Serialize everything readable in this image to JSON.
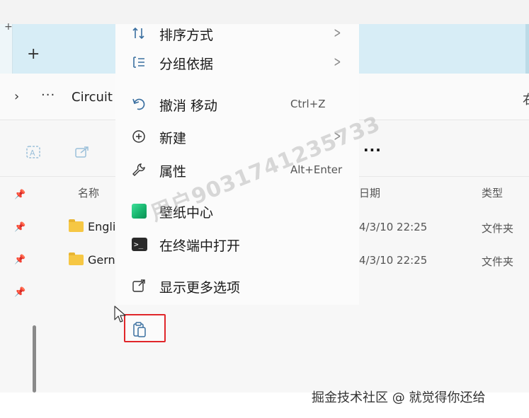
{
  "explorer": {
    "top_plus": "+",
    "new_tab_icon": "plus-icon",
    "new_tab_label": "+",
    "address": {
      "chevron": "›",
      "more": "···",
      "crumb": "Circuit",
      "right_glyph": "右"
    },
    "command_bar": {
      "more": "···",
      "icons": [
        "rename-icon",
        "share-icon"
      ]
    },
    "columns": {
      "name": "名称",
      "date": "日期",
      "type": "类型"
    },
    "rows": [
      {
        "name": "Engli",
        "date": "4/3/10 22:25",
        "type": "文件夹"
      },
      {
        "name": "Gern",
        "date": "4/3/10 22:25",
        "type": "文件夹"
      }
    ]
  },
  "context_menu": {
    "items": [
      {
        "label": "排序方式",
        "icon": "sort-icon",
        "has_submenu": true
      },
      {
        "label": "分组依据",
        "icon": "group-icon",
        "has_submenu": true
      },
      {
        "label": "撤消 移动",
        "icon": "undo-icon",
        "shortcut": "Ctrl+Z"
      },
      {
        "label": "新建",
        "icon": "new-icon",
        "has_submenu": true
      },
      {
        "label": "属性",
        "icon": "wrench-icon",
        "shortcut": "Alt+Enter"
      },
      {
        "label": "壁纸中心",
        "icon": "wallpaper-icon"
      },
      {
        "label": "在终端中打开",
        "icon": "terminal-icon"
      },
      {
        "label": "显示更多选项",
        "icon": "more-options-icon"
      }
    ],
    "paste_icon": "paste-icon",
    "highlight_color": "#e0262a"
  },
  "watermarks": {
    "diagonal": "用户9031741235733",
    "site": "掘金技术社区 @ 就觉得你还给"
  },
  "colors": {
    "titlebar": "#d7edf6",
    "folder": "#f6c744",
    "menu_bg": "#fbfbfb",
    "icon_blue": "#3a6fa0"
  }
}
